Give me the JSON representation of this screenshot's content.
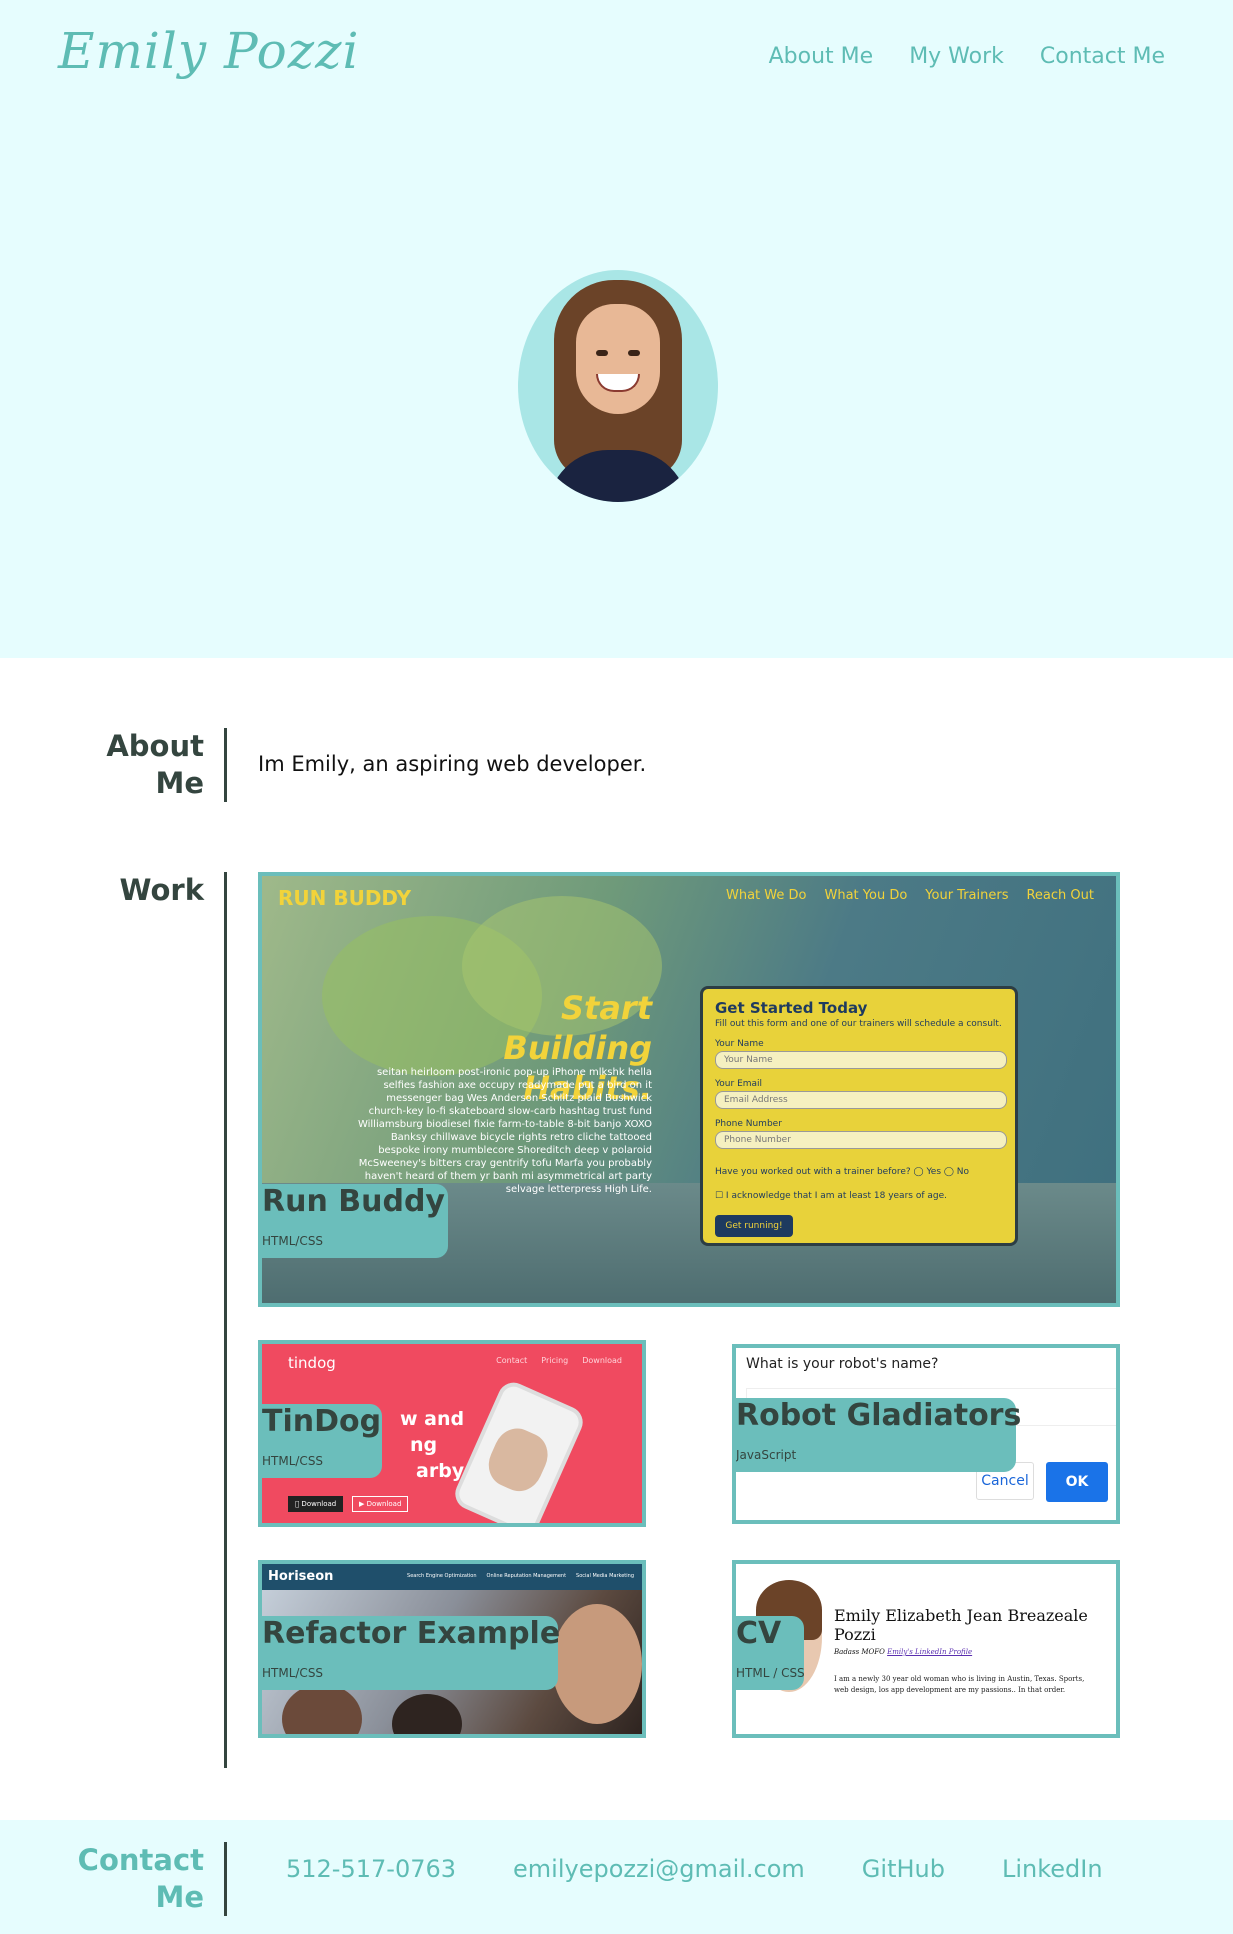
{
  "header": {
    "brand": "Emily Pozzi",
    "nav": [
      "About Me",
      "My Work",
      "Contact Me"
    ]
  },
  "about": {
    "label_line1": "About",
    "label_line2": "Me",
    "text": "Im Emily, an aspiring web developer."
  },
  "work": {
    "label": "Work",
    "projects": [
      {
        "title": "Run Buddy",
        "tag": "HTML/CSS"
      },
      {
        "title": "TinDog",
        "tag": "HTML/CSS"
      },
      {
        "title": "Robot Gladiators",
        "tag": "JavaScript"
      },
      {
        "title": "Refactor Example",
        "tag": "HTML/CSS"
      },
      {
        "title": "CV",
        "tag": "HTML / CSS"
      }
    ],
    "previews": {
      "run_buddy": {
        "logo": "RUN BUDDY",
        "nav": [
          "What We Do",
          "What You Do",
          "Your Trainers",
          "Reach Out"
        ],
        "headline_1": "Start Building",
        "headline_2": "Habits.",
        "paragraph": "seitan heirloom post-ironic pop-up iPhone mlkshk hella selfies fashion axe occupy readymade put a bird on it messenger bag Wes Anderson Schlitz plaid Bushwick church-key lo-fi skateboard slow-carb hashtag trust fund Williamsburg biodiesel fixie farm-to-table 8-bit banjo XOXO Banksy chillwave bicycle rights retro cliche tattooed bespoke irony mumblecore Shoreditch deep v polaroid McSweeney's bitters cray gentrify tofu Marfa you probably haven't heard of them yr banh mi asymmetrical art party selvage letterpress High Life.",
        "form_title": "Get Started Today",
        "form_sub": "Fill out this form and one of our trainers will schedule a consult.",
        "name_label": "Your Name",
        "name_placeholder": "Your Name",
        "email_label": "Your Email",
        "email_placeholder": "Email Address",
        "phone_label": "Phone Number",
        "phone_placeholder": "Phone Number",
        "question": "Have you worked out with a trainer before?  ◯ Yes  ◯ No",
        "checkbox": "☐  I acknowledge that I am at least 18 years of age.",
        "button": "Get running!"
      },
      "tindog": {
        "logo": "tindog",
        "nav": [
          "Contact",
          "Pricing",
          "Download"
        ],
        "hero_line1": "w and",
        "hero_line2": "ng",
        "hero_line3": "arby.",
        "btn1": " Download",
        "btn2": "▶ Download"
      },
      "robot": {
        "question": "What is your robot's name?",
        "cancel": "Cancel",
        "ok": "OK"
      },
      "horiseon": {
        "logo": "Horiseon",
        "nav": [
          "Search Engine Optimization",
          "Online Reputation Management",
          "Social Media Marketing"
        ]
      },
      "cv": {
        "name": "Emily Elizabeth Jean Breazeale Pozzi",
        "sub_prefix": "Badass MOFO ",
        "sub_link": "Emily's LinkedIn Profile",
        "body": "I am a newly 30 year old woman who is living in Austin, Texas. Sports, web design, los app development are my passions.. In that order."
      }
    }
  },
  "contact": {
    "label_line1": "Contact",
    "label_line2": "Me",
    "links": [
      "512-517-0763",
      "emilyepozzi@gmail.com",
      "GitHub",
      "LinkedIn"
    ]
  },
  "colors": {
    "hero_bg": "#e6fdfe",
    "accent": "#5ebcb4",
    "card_border": "#6bbebb",
    "heading": "#34453f"
  }
}
